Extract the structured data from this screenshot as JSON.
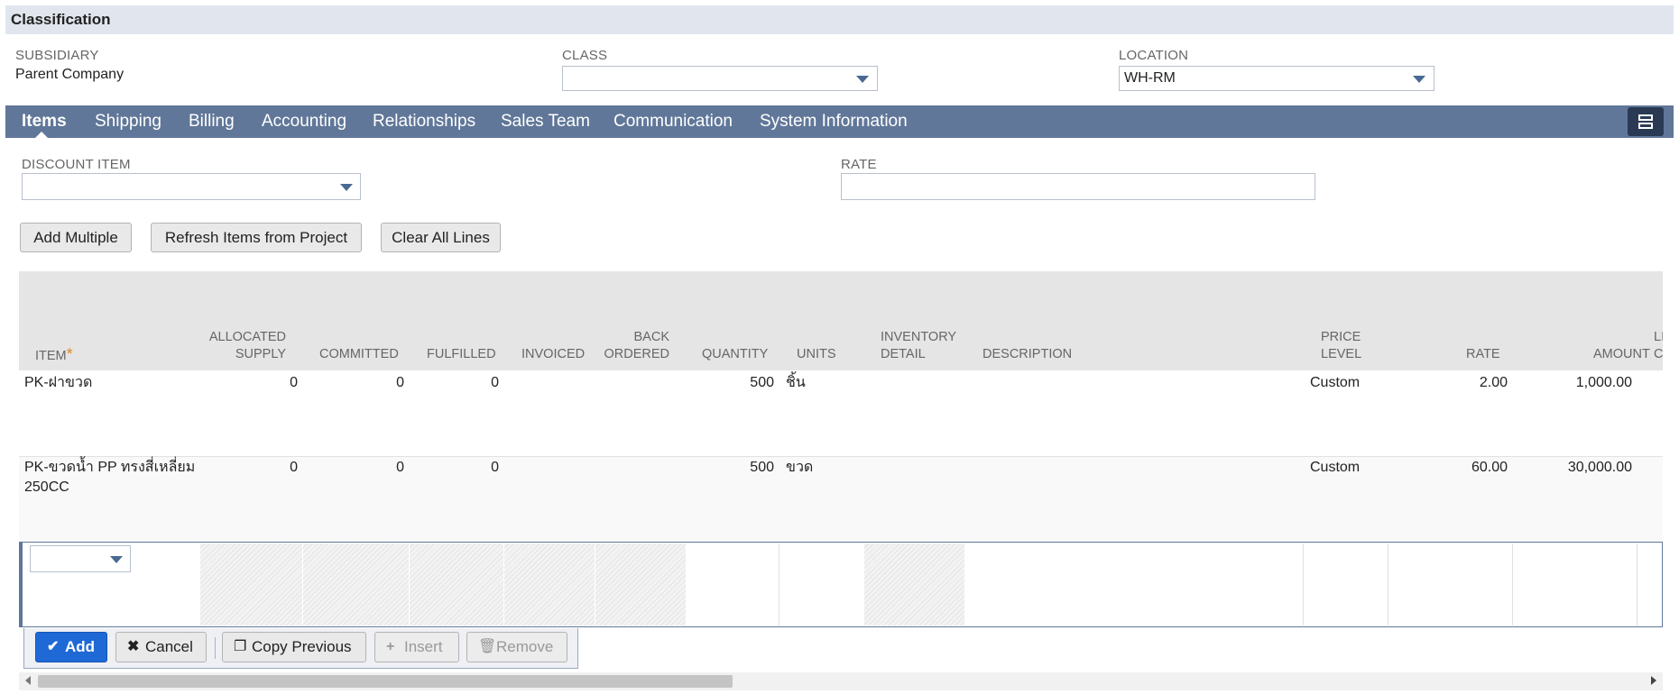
{
  "section": {
    "title": "Classification"
  },
  "fields": {
    "subsidiary_label": "SUBSIDIARY",
    "subsidiary_value": "Parent Company",
    "class_label": "CLASS",
    "class_value": "",
    "location_label": "LOCATION",
    "location_value": "WH-RM"
  },
  "tabs": [
    {
      "label": "Items",
      "active": true
    },
    {
      "label": "Shipping"
    },
    {
      "label": "Billing"
    },
    {
      "label": "Accounting"
    },
    {
      "label": "Relationships"
    },
    {
      "label": "Sales Team"
    },
    {
      "label": "Communication"
    },
    {
      "label": "System Information"
    }
  ],
  "items_form": {
    "discount_item_label": "DISCOUNT ITEM",
    "discount_item_value": "",
    "rate_label": "RATE",
    "rate_value": ""
  },
  "buttons": {
    "add_multiple": "Add Multiple",
    "refresh_items": "Refresh Items from Project",
    "clear_all": "Clear All Lines"
  },
  "table": {
    "columns": {
      "item": "ITEM",
      "required_mark": "*",
      "allocated_1": "ALLOCATED",
      "allocated_2": "SUPPLY",
      "committed": "COMMITTED",
      "fulfilled": "FULFILLED",
      "invoiced": "INVOICED",
      "back_1": "BACK",
      "back_2": "ORDERED",
      "quantity": "QUANTITY",
      "units": "UNITS",
      "inv_1": "INVENTORY",
      "inv_2": "DETAIL",
      "description": "DESCRIPTION",
      "price_1": "PRICE",
      "price_2": "LEVEL",
      "rate": "RATE",
      "amount": "AMOUNT",
      "cut_1": "LI",
      "cut_2": "C"
    },
    "rows": [
      {
        "item": "PK-ฝาขวด",
        "item_line2": "",
        "allocated": "0",
        "committed": "0",
        "fulfilled": "0",
        "quantity": "500",
        "units": "ชิ้น",
        "price_level": "Custom",
        "rate": "2.00",
        "amount": "1,000.00"
      },
      {
        "item": "PK-ขวดน้ำ PP ทรงสี่เหลี่ยม",
        "item_line2": "250CC",
        "allocated": "0",
        "committed": "0",
        "fulfilled": "0",
        "quantity": "500",
        "units": "ขวด",
        "price_level": "Custom",
        "rate": "60.00",
        "amount": "30,000.00"
      }
    ]
  },
  "line_toolbar": {
    "add": "Add",
    "cancel": "Cancel",
    "copy_previous": "Copy Previous",
    "insert": "Insert",
    "remove": "Remove"
  },
  "icons": {
    "dropdown": "chevron-down-icon",
    "layout": "layout-toggle-icon",
    "check": "check-icon",
    "close": "close-icon",
    "copy": "copy-icon",
    "plus": "plus-icon",
    "trash": "trash-icon"
  },
  "colors": {
    "tab_bar": "#607799",
    "primary_button": "#1f69d6",
    "required": "#e08a1e"
  }
}
